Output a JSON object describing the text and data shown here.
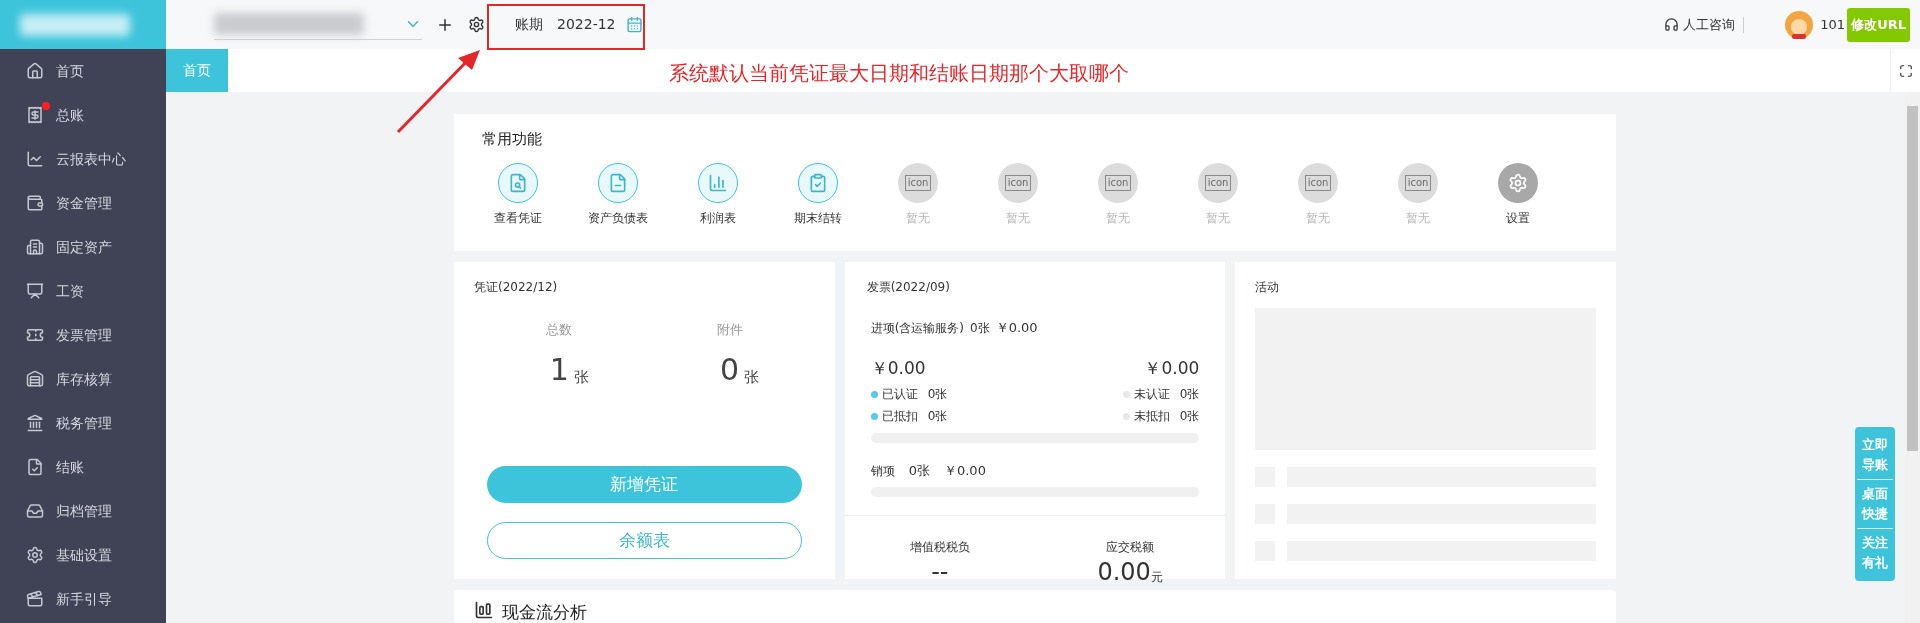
{
  "header": {
    "period_label": "账期",
    "period_value": "2022-12",
    "support": "人工咨询",
    "user_id": "101",
    "url_button": "修改URL"
  },
  "annotation": {
    "text": "系统默认当前凭证最大日期和结账日期那个大取哪个"
  },
  "sidebar": {
    "items": [
      {
        "label": "首页",
        "dot": false
      },
      {
        "label": "总账",
        "dot": true
      },
      {
        "label": "云报表中心",
        "dot": false
      },
      {
        "label": "资金管理",
        "dot": false
      },
      {
        "label": "固定资产",
        "dot": false
      },
      {
        "label": "工资",
        "dot": false
      },
      {
        "label": "发票管理",
        "dot": false
      },
      {
        "label": "库存核算",
        "dot": false
      },
      {
        "label": "税务管理",
        "dot": false
      },
      {
        "label": "结账",
        "dot": false
      },
      {
        "label": "归档管理",
        "dot": false
      },
      {
        "label": "基础设置",
        "dot": false
      },
      {
        "label": "新手引导",
        "dot": false
      }
    ]
  },
  "tabs": [
    {
      "label": "首页",
      "selected": true
    }
  ],
  "functions": {
    "title": "常用功能",
    "items": [
      {
        "label": "查看凭证",
        "kind": "feature"
      },
      {
        "label": "资产负债表",
        "kind": "feature"
      },
      {
        "label": "利润表",
        "kind": "feature"
      },
      {
        "label": "期末结转",
        "kind": "feature"
      },
      {
        "label": "暂无",
        "kind": "placeholder",
        "icon_text": "icon"
      },
      {
        "label": "暂无",
        "kind": "placeholder",
        "icon_text": "icon"
      },
      {
        "label": "暂无",
        "kind": "placeholder",
        "icon_text": "icon"
      },
      {
        "label": "暂无",
        "kind": "placeholder",
        "icon_text": "icon"
      },
      {
        "label": "暂无",
        "kind": "placeholder",
        "icon_text": "icon"
      },
      {
        "label": "暂无",
        "kind": "placeholder",
        "icon_text": "icon"
      },
      {
        "label": "设置",
        "kind": "settings"
      }
    ]
  },
  "voucher": {
    "title": "凭证(2022/12)",
    "stats": [
      {
        "label": "总数",
        "value": "1",
        "unit": "张"
      },
      {
        "label": "附件",
        "value": "0",
        "unit": "张"
      }
    ],
    "buttons": [
      {
        "label": "新增凭证",
        "kind": "primary"
      },
      {
        "label": "余额表",
        "kind": "outline"
      }
    ]
  },
  "invoice": {
    "title": "发票(2022/09)",
    "input": {
      "label": "进项(含运输服务)",
      "count": "0张",
      "amount": "￥0.00"
    },
    "totals": [
      "￥0.00",
      "￥0.00"
    ],
    "statuses": [
      {
        "label": "已认证",
        "count": "0张",
        "color": "#5bc8e6"
      },
      {
        "label": "未认证",
        "count": "0张",
        "color": "#e8e8e8"
      },
      {
        "label": "已抵扣",
        "count": "0张",
        "color": "#5bc8e6"
      },
      {
        "label": "未抵扣",
        "count": "0张",
        "color": "#e8e8e8"
      }
    ],
    "output": {
      "label": "销项",
      "count": "0张",
      "amount": "￥0.00"
    },
    "tax": [
      {
        "label": "增值税税负",
        "value": "--"
      },
      {
        "label": "应交税额",
        "value": "0.00",
        "unit": "元"
      }
    ]
  },
  "activity": {
    "title": "活动"
  },
  "side_actions": [
    {
      "label": "立即导账"
    },
    {
      "label": "桌面快捷"
    },
    {
      "label": "关注有礼"
    }
  ],
  "cashflow": {
    "title": "现金流分析"
  }
}
